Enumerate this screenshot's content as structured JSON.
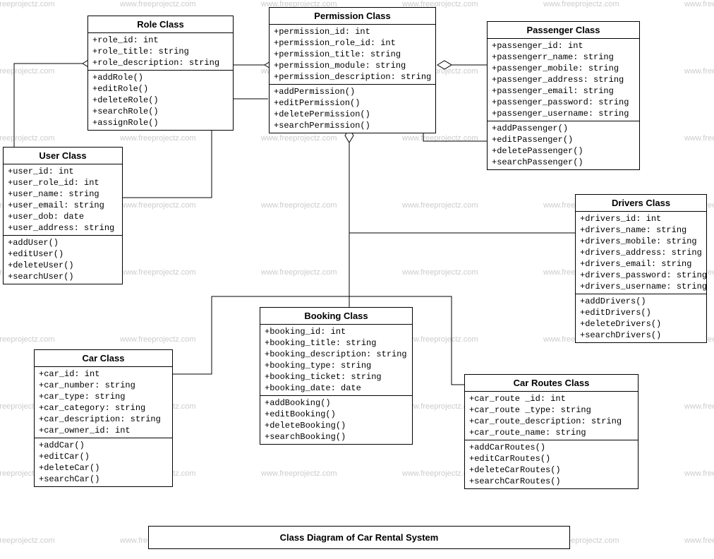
{
  "diagram_title": "Class Diagram of Car Rental System",
  "watermark": "www.freeprojectz.com",
  "classes": {
    "role": {
      "title": "Role Class",
      "attrs": [
        "+role_id: int",
        "+role_title: string",
        "+role_description: string"
      ],
      "ops": [
        "+addRole()",
        "+editRole()",
        "+deleteRole()",
        "+searchRole()",
        "+assignRole()"
      ]
    },
    "permission": {
      "title": "Permission Class",
      "attrs": [
        "+permission_id: int",
        "+permission_role_id: int",
        "+permission_title: string",
        "+permission_module: string",
        "+permission_description: string"
      ],
      "ops": [
        "+addPermission()",
        "+editPermission()",
        "+deletePermission()",
        "+searchPermission()"
      ]
    },
    "passenger": {
      "title": "Passenger Class",
      "attrs": [
        "+passenger_id: int",
        "+passengerr_name: string",
        "+passenger_mobile: string",
        "+passenger_address: string",
        "+passenger_email: string",
        "+passenger_password: string",
        "+passenger_username: string"
      ],
      "ops": [
        "+addPassenger()",
        "+editPassenger()",
        "+deletePassenger()",
        "+searchPassenger()"
      ]
    },
    "user": {
      "title": "User Class",
      "attrs": [
        "+user_id: int",
        "+user_role_id: int",
        "+user_name: string",
        "+user_email: string",
        "+user_dob: date",
        "+user_address: string"
      ],
      "ops": [
        "+addUser()",
        "+editUser()",
        "+deleteUser()",
        "+searchUser()"
      ]
    },
    "drivers": {
      "title": "Drivers Class",
      "attrs": [
        "+drivers_id: int",
        "+drivers_name: string",
        "+drivers_mobile: string",
        "+drivers_address: string",
        "+drivers_email: string",
        "+drivers_password: string",
        "+drivers_username: string"
      ],
      "ops": [
        "+addDrivers()",
        "+editDrivers()",
        "+deleteDrivers()",
        "+searchDrivers()"
      ]
    },
    "booking": {
      "title": "Booking Class",
      "attrs": [
        "+booking_id: int",
        "+booking_title: string",
        "+booking_description: string",
        "+booking_type: string",
        "+booking_ticket: string",
        "+booking_date: date"
      ],
      "ops": [
        "+addBooking()",
        "+editBooking()",
        "+deleteBooking()",
        "+searchBooking()"
      ]
    },
    "car": {
      "title": "Car Class",
      "attrs": [
        "+car_id: int",
        "+car_number: string",
        "+car_type: string",
        "+car_category: string",
        "+car_description: string",
        "+car_owner_id: int"
      ],
      "ops": [
        "+addCar()",
        "+editCar()",
        "+deleteCar()",
        "+searchCar()"
      ]
    },
    "carroutes": {
      "title": "Car Routes Class",
      "attrs": [
        "+car_route _id: int",
        "+car_route _type: string",
        "+car_route_description: string",
        "+car_route_name: string"
      ],
      "ops": [
        "+addCarRoutes()",
        "+editCarRoutes()",
        "+deleteCarRoutes()",
        "+searchCarRoutes()"
      ]
    }
  }
}
